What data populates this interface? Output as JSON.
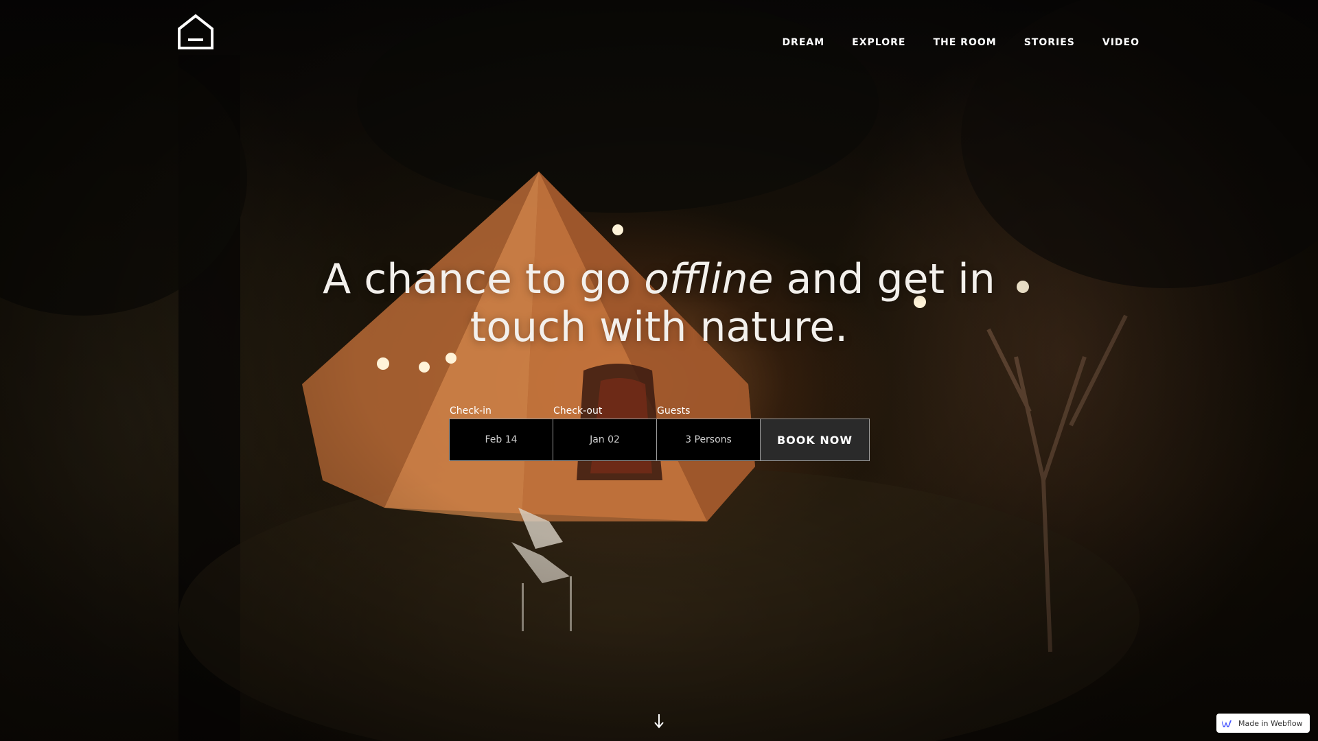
{
  "header": {
    "logo_icon": "house-outline-icon",
    "nav": [
      {
        "label": "DREAM"
      },
      {
        "label": "EXPLORE"
      },
      {
        "label": "THE ROOM"
      },
      {
        "label": "STORIES"
      },
      {
        "label": "VIDEO"
      }
    ]
  },
  "hero": {
    "title_before": "A chance to go ",
    "title_italic": "offline",
    "title_after": " and get in touch with nature."
  },
  "booking": {
    "checkin_label": "Check-in",
    "checkin_value": "Feb 14",
    "checkout_label": "Check-out",
    "checkout_value": "Jan 02",
    "guests_label": "Guests",
    "guests_value": "3 Persons",
    "button_label": "BOOK NOW"
  },
  "scroll": {
    "icon": "arrow-down-icon"
  },
  "badge": {
    "icon": "webflow-logo-icon",
    "label": "Made in Webflow",
    "icon_color": "#4353ff"
  },
  "colors": {
    "text": "#ffffff",
    "field_background": "#000000",
    "button_background": "#2a2a2a",
    "border": "#9a9a9a"
  }
}
